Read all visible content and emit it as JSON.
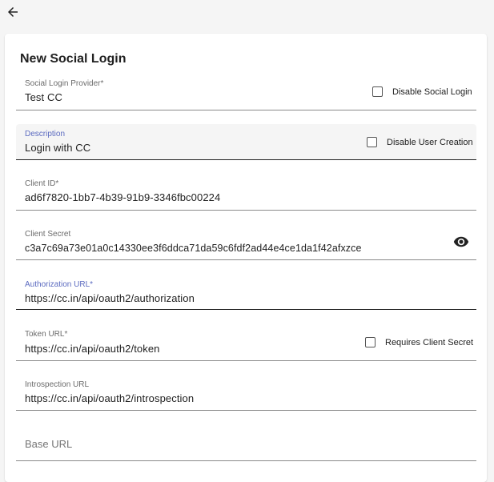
{
  "back_button_icon": "arrow-left-icon",
  "title": "New Social Login",
  "fields": {
    "provider": {
      "label": "Social Login Provider*",
      "value": "Test CC"
    },
    "description": {
      "label": "Description",
      "value": "Login with CC"
    },
    "client_id": {
      "label": "Client ID*",
      "value": "ad6f7820-1bb7-4b39-91b9-3346fbc00224"
    },
    "client_secret": {
      "label": "Client Secret",
      "value": "c3a7c69a73e01a0c14330ee3f6ddca71da59c6fdf2ad44e4ce1da1f42afxzce",
      "visibility_icon": "eye-icon"
    },
    "authorization_url": {
      "label": "Authorization URL*",
      "value": "https://cc.in/api/oauth2/authorization"
    },
    "token_url": {
      "label": "Token URL*",
      "value": "https://cc.in/api/oauth2/token"
    },
    "introspection_url": {
      "label": "Introspection URL",
      "value": "https://cc.in/api/oauth2/introspection"
    },
    "base_url": {
      "placeholder": "Base URL",
      "value": ""
    }
  },
  "checkboxes": {
    "disable_social_login": {
      "label": "Disable Social Login",
      "checked": false
    },
    "disable_user_creation": {
      "label": "Disable User Creation",
      "checked": false
    },
    "requires_client_secret": {
      "label": "Requires Client Secret",
      "checked": false
    }
  },
  "colors": {
    "focused_label": "#5c6bc0",
    "page_background": "#f5f5f5",
    "card_background": "#ffffff"
  }
}
